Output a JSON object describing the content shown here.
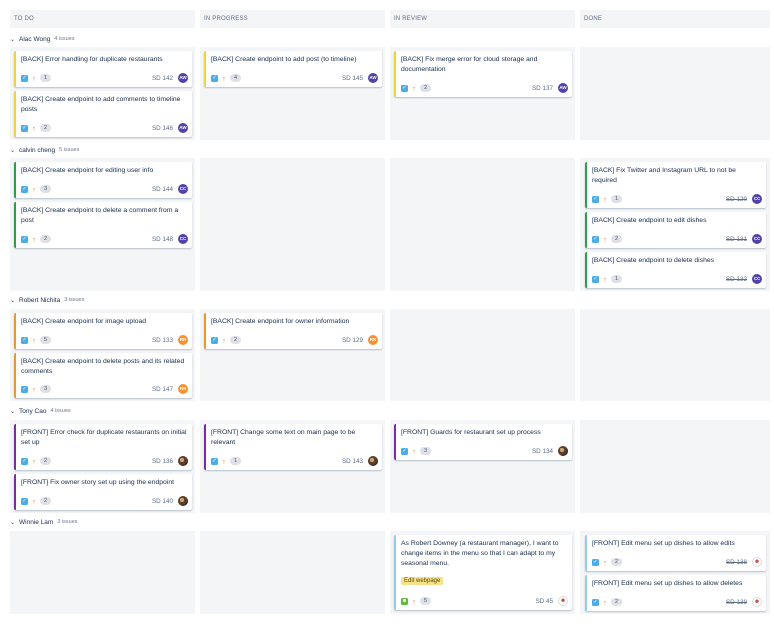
{
  "columns": [
    "TO DO",
    "IN PROGRESS",
    "IN REVIEW",
    "DONE"
  ],
  "colors": {
    "yellow": "#f0d43a",
    "green": "#22a447",
    "orange": "#f0972b",
    "purple": "#7b2aa8",
    "blue": "#8fd0ea"
  },
  "swimlanes": [
    {
      "name": "Alac Wong",
      "count": "4 issues"
    },
    {
      "name": "calvin cheng",
      "count": "5 issues"
    },
    {
      "name": "Robert Nichita",
      "count": "3 issues"
    },
    {
      "name": "Tony Cao",
      "count": "4 issues"
    },
    {
      "name": "Winnie Lam",
      "count": "3 issues"
    }
  ],
  "cards": {
    "aw_todo_1": {
      "summary": "[BACK] Error handling for duplicate restaurants",
      "points": "1",
      "key": "SD 142",
      "avatar": "AW"
    },
    "aw_todo_2": {
      "summary": "[BACK] Create endpoint to add comments to timeline posts",
      "points": "2",
      "key": "SD 146",
      "avatar": "AW"
    },
    "aw_prog_1": {
      "summary": "[BACK] Create endpoint to add post (to timeline)",
      "points": "4",
      "key": "SD 145",
      "avatar": "AW"
    },
    "aw_rev_1": {
      "summary": "[BACK] Fix merge error for cloud storage and documentation",
      "points": "2",
      "key": "SD 137",
      "avatar": "AW"
    },
    "cc_todo_1": {
      "summary": "[BACK] Create endpoint for editing user info",
      "points": "3",
      "key": "SD 144",
      "avatar": "CC"
    },
    "cc_todo_2": {
      "summary": "[BACK] Create endpoint to delete a comment from a post",
      "points": "2",
      "key": "SD 148",
      "avatar": "CC"
    },
    "cc_done_1": {
      "summary": "[BACK] Fix Twitter and Instagram URL to not be required",
      "points": "1",
      "key": "SD 120",
      "avatar": "CC"
    },
    "cc_done_2": {
      "summary": "[BACK] Create endpoint to edit dishes",
      "points": "2",
      "key": "SD 131",
      "avatar": "CC"
    },
    "cc_done_3": {
      "summary": "[BACK] Create endpoint to delete dishes",
      "points": "1",
      "key": "SD 132",
      "avatar": "CC"
    },
    "rn_todo_1": {
      "summary": "[BACK] Create endpoint for image upload",
      "points": "5",
      "key": "SD 133",
      "avatar": "RN"
    },
    "rn_todo_2": {
      "summary": "[BACK] Create endpoint to delete posts and its related comments",
      "points": "3",
      "key": "SD 147",
      "avatar": "RN"
    },
    "rn_prog_1": {
      "summary": "[BACK] Create endpoint for owner information",
      "points": "2",
      "key": "SD 129",
      "avatar": "RN"
    },
    "tc_todo_1": {
      "summary": "[FRONT] Error check for duplicate restaurants on initial set up",
      "points": "2",
      "key": "SD 136"
    },
    "tc_todo_2": {
      "summary": "[FRONT] Fix owner story set up using the endpoint",
      "points": "2",
      "key": "SD 140"
    },
    "tc_prog_1": {
      "summary": "[FRONT] Change some text on main page to be relevant",
      "points": "1",
      "key": "SD 143"
    },
    "tc_rev_1": {
      "summary": "[FRONT] Guards for restaurant set up process",
      "points": "3",
      "key": "SD 134"
    },
    "wl_rev_1": {
      "summary": "As Robert Downey (a restaurant manager), I want to change items in the menu so that I can adapt to my seasonal menu.",
      "epic": "Edit webpage",
      "points": "5",
      "key": "SD 45"
    },
    "wl_done_1": {
      "summary": "[FRONT] Edit menu set up dishes to allow edits",
      "points": "2",
      "key": "SD 138"
    },
    "wl_done_2": {
      "summary": "[FRONT] Edit menu set up dishes to allow deletes",
      "points": "2",
      "key": "SD 139"
    }
  }
}
